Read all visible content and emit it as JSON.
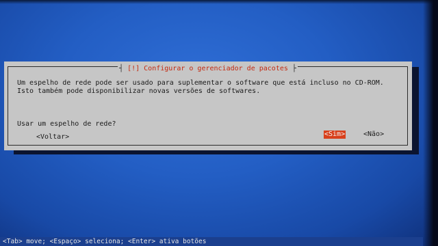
{
  "dialog": {
    "title_left": "[!]",
    "title": "Configurar o gerenciador de pacotes",
    "description_line1": "Um espelho de rede pode ser usado para suplementar o software que está incluso no CD-ROM.",
    "description_line2": "Isto também pode disponibilizar novas versões de softwares.",
    "question": "Usar um espelho de rede?",
    "back_label": "<Voltar>",
    "yes_label": "<Sim>",
    "no_label": "<Não>",
    "selected_button": "yes"
  },
  "status_bar": {
    "text": "<Tab> move; <Espaço> seleciona; <Enter> ativa botões"
  },
  "colors": {
    "background": "#235ec4",
    "dialog": "#c6c6c6",
    "title": "#c42a10",
    "selected_button": "#d8401c"
  }
}
